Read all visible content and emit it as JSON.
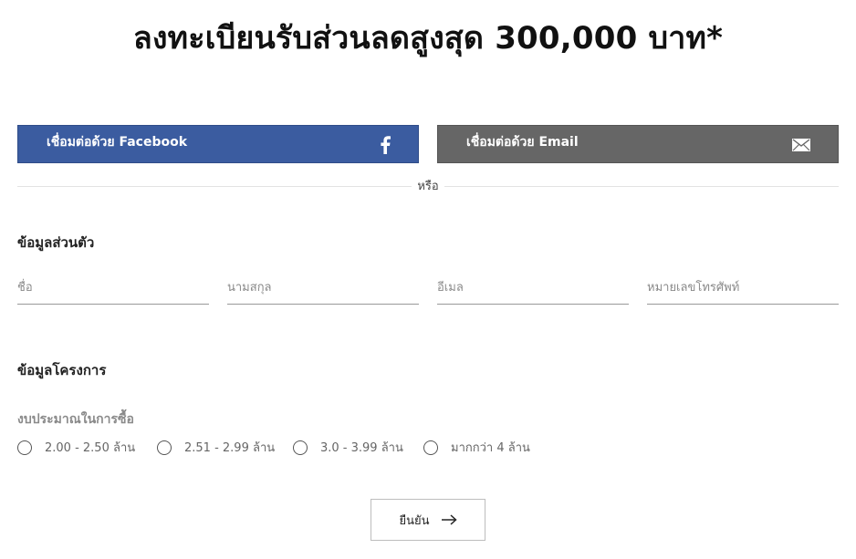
{
  "header": {
    "title": "ลงทะเบียนรับส่วนลดสูงสุด 300,000 บาท*"
  },
  "social": {
    "facebook_label": "เชื่อมต่อด้วย Facebook",
    "email_label": "เชื่อมต่อด้วย Email",
    "facebook_color": "#3b5ca0",
    "email_color": "#666666",
    "facebook_icon": "facebook-icon",
    "email_icon": "envelope-icon"
  },
  "divider": {
    "text": "หรือ"
  },
  "personal": {
    "title": "ข้อมูลส่วนตัว",
    "fields": [
      {
        "placeholder": "ชื่อ",
        "value": ""
      },
      {
        "placeholder": "นามสกุล",
        "value": ""
      },
      {
        "placeholder": "อีเมล",
        "value": ""
      },
      {
        "placeholder": "หมายเลขโทรศัพท์",
        "value": ""
      }
    ]
  },
  "project": {
    "title": "ข้อมูลโครงการ",
    "budget_label": "งบประมาณในการซื้อ",
    "options": [
      {
        "label": "2.00 - 2.50 ล้าน",
        "checked": false
      },
      {
        "label": "2.51 - 2.99 ล้าน",
        "checked": false
      },
      {
        "label": "3.0 - 3.99 ล้าน",
        "checked": false
      },
      {
        "label": "มากกว่า 4 ล้าน",
        "checked": false
      }
    ]
  },
  "submit": {
    "label": "ยืนยัน",
    "icon": "arrow-right-icon"
  }
}
